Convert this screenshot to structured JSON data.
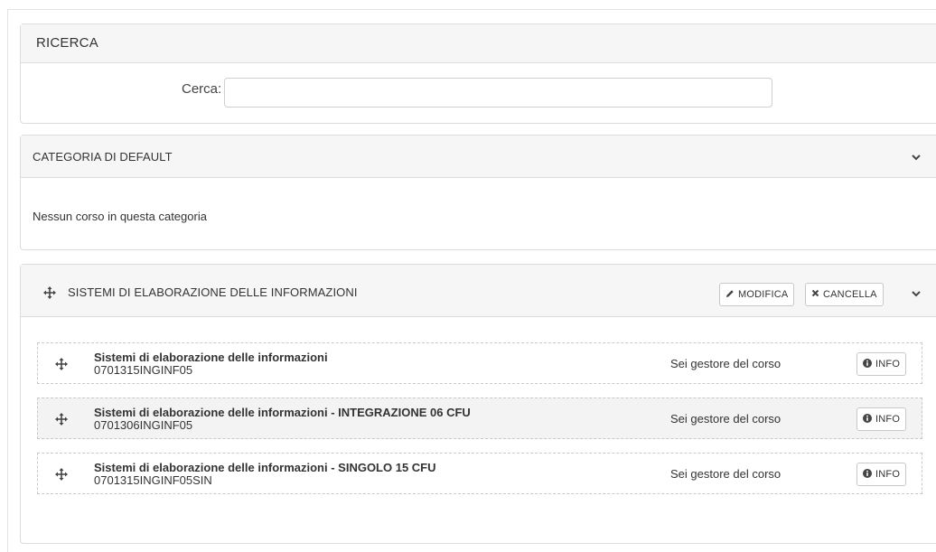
{
  "search": {
    "title": "RICERCA",
    "label": "Cerca:",
    "value": "",
    "placeholder": ""
  },
  "default_category": {
    "title": "CATEGORIA DI DEFAULT",
    "empty_text": "Nessun corso in questa categoria",
    "toggle_icon": "chevron-down-icon"
  },
  "category": {
    "title": "SISTEMI DI ELABORAZIONE DELLE INFORMAZIONI",
    "drag_icon": "move-icon",
    "edit_label": "MODIFICA",
    "edit_icon": "pencil-icon",
    "delete_label": "CANCELLA",
    "delete_icon": "times-icon",
    "toggle_icon": "chevron-down-icon",
    "courses": [
      {
        "name": "Sistemi di elaborazione delle informazioni",
        "code": "0701315INGINF05",
        "status": "Sei gestore del corso",
        "info_label": "INFO"
      },
      {
        "name": "Sistemi di elaborazione delle informazioni - INTEGRAZIONE 06 CFU",
        "code": "0701306INGINF05",
        "status": "Sei gestore del corso",
        "info_label": "INFO"
      },
      {
        "name": "Sistemi di elaborazione delle informazioni - SINGOLO 15 CFU",
        "code": "0701315INGINF05SIN",
        "status": "Sei gestore del corso",
        "info_label": "INFO"
      }
    ]
  },
  "colors": {
    "panel_header_bg": "#f6f6f6",
    "border": "#dcdcdc",
    "text": "#333333",
    "alt_row_bg": "#f3f3f3"
  }
}
